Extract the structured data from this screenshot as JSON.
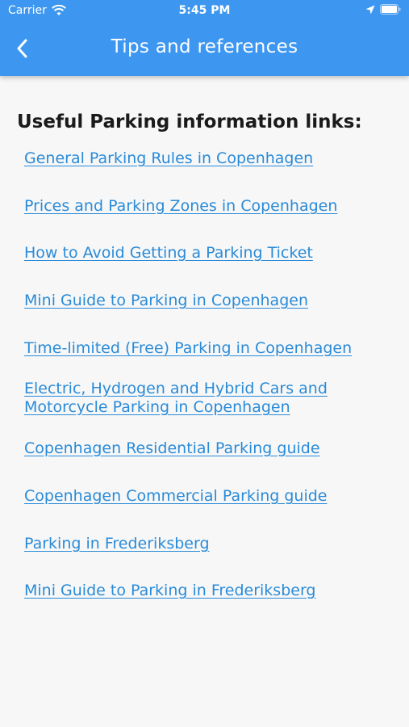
{
  "status_bar": {
    "carrier": "Carrier",
    "time": "5:45 PM",
    "icons": [
      "wifi-icon",
      "location-arrow-icon",
      "battery-icon"
    ]
  },
  "header": {
    "title": "Tips and references",
    "back_icon": "chevron-left-icon",
    "color": "#3d97f0"
  },
  "main": {
    "heading": "Useful Parking information links:",
    "link_color": "#2a8bd8",
    "links": [
      {
        "label": "General Parking Rules in Copenhagen"
      },
      {
        "label": "Prices and Parking Zones in Copenhagen"
      },
      {
        "label": "How to Avoid Getting a Parking Ticket"
      },
      {
        "label": "Mini Guide to Parking in Copenhagen"
      },
      {
        "label": "Time-limited (Free) Parking in Copenhagen"
      },
      {
        "label": "Electric, Hydrogen and Hybrid Cars and Motorcycle Parking in Copenhagen"
      },
      {
        "label": "Copenhagen Residential Parking guide"
      },
      {
        "label": "Copenhagen Commercial Parking guide"
      },
      {
        "label": "Parking in Frederiksberg"
      },
      {
        "label": "Mini Guide to Parking in Frederiksberg"
      }
    ]
  }
}
